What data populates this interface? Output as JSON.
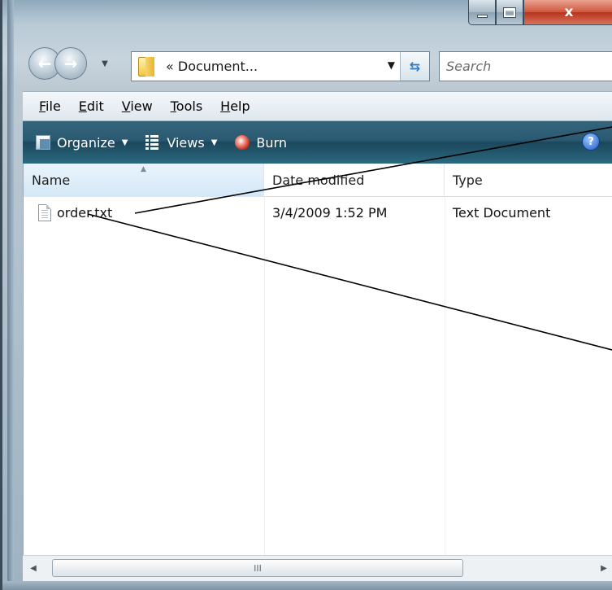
{
  "window": {
    "minimize_icon": "minimize-icon",
    "maximize_icon": "maximize-icon",
    "close_label": "x"
  },
  "nav": {
    "back_icon": "back-arrow-icon",
    "forward_icon": "forward-arrow-icon",
    "address_text": "« Document...",
    "address_dropdown_glyph": "▼",
    "refresh_icon": "refresh-icon",
    "search_placeholder": "Search"
  },
  "menubar": {
    "items": [
      {
        "key": "F",
        "rest": "ile"
      },
      {
        "key": "E",
        "rest": "dit"
      },
      {
        "key": "V",
        "rest": "iew"
      },
      {
        "key": "T",
        "rest": "ools"
      },
      {
        "key": "H",
        "rest": "elp"
      }
    ]
  },
  "commandbar": {
    "organize_label": "Organize",
    "views_label": "Views",
    "burn_label": "Burn",
    "help_glyph": "?"
  },
  "filelist": {
    "columns": [
      "Name",
      "Date modified",
      "Type"
    ],
    "rows": [
      {
        "name": "order.txt",
        "date": "3/4/2009 1:52 PM",
        "type": "Text Document"
      }
    ]
  },
  "scrollbar": {
    "left_arrow": "◀",
    "right_arrow": "▶",
    "thumb_grip": "III"
  },
  "colors": {
    "command_bar": "#2a5a72",
    "close_button": "#c9452c",
    "annotation_lines": "#000000"
  }
}
